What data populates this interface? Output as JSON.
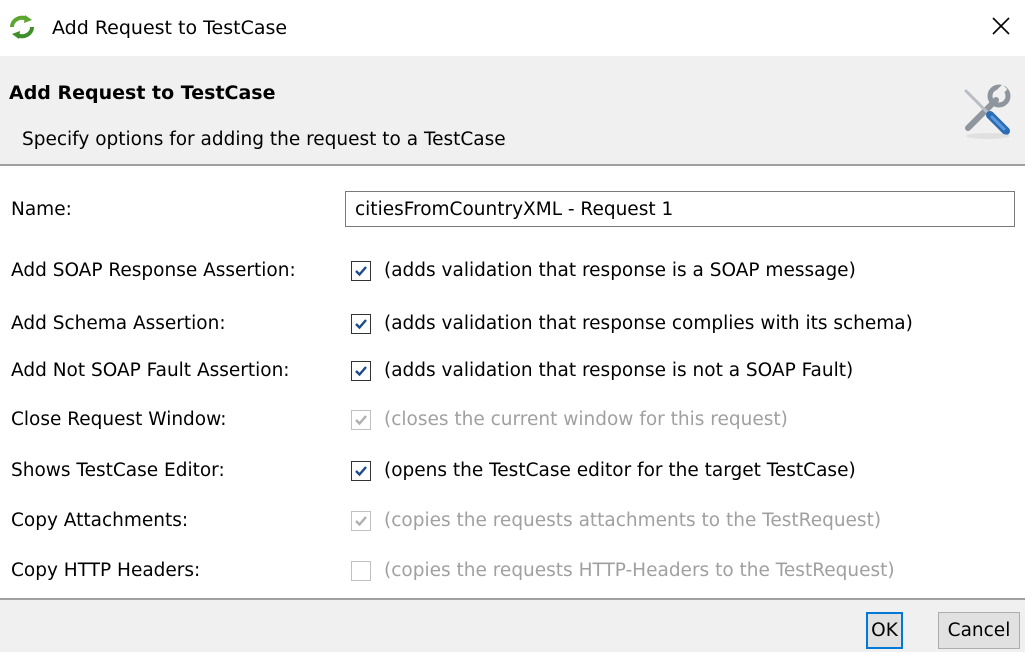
{
  "window": {
    "title": "Add Request to TestCase",
    "app_icon": "soapui-logo-icon",
    "close_icon": "close-icon"
  },
  "header": {
    "title": "Add Request to TestCase",
    "description": "Specify options for adding the request to a TestCase",
    "icon": "tools-icon"
  },
  "form": {
    "name_label": "Name:",
    "name_value": "citiesFromCountryXML - Request 1",
    "options": [
      {
        "label": "Add SOAP Response Assertion:",
        "description": "(adds validation that response is a SOAP message)",
        "checked": true,
        "enabled": true
      },
      {
        "label": "Add Schema Assertion:",
        "description": "(adds validation that response complies with its schema)",
        "checked": true,
        "enabled": true
      },
      {
        "label": "Add Not SOAP Fault Assertion:",
        "description": "(adds validation that response is not a SOAP Fault)",
        "checked": true,
        "enabled": true
      },
      {
        "label": "Close Request Window:",
        "description": "(closes the current window for this request)",
        "checked": true,
        "enabled": false
      },
      {
        "label": "Shows TestCase Editor:",
        "description": "(opens the TestCase editor for the target TestCase)",
        "checked": true,
        "enabled": true
      },
      {
        "label": "Copy Attachments:",
        "description": "(copies the requests attachments to the TestRequest)",
        "checked": true,
        "enabled": false
      },
      {
        "label": "Copy HTTP Headers:",
        "description": "(copies the requests HTTP-Headers to the TestRequest)",
        "checked": false,
        "enabled": false
      }
    ]
  },
  "buttons": {
    "ok": "OK",
    "cancel": "Cancel"
  },
  "colors": {
    "check_enabled": "#1c4a8c",
    "check_disabled": "#b0b0b0",
    "default_button_border": "#0078d7",
    "header_background": "#f0f0f0",
    "logo_green": "#5aa62f"
  }
}
